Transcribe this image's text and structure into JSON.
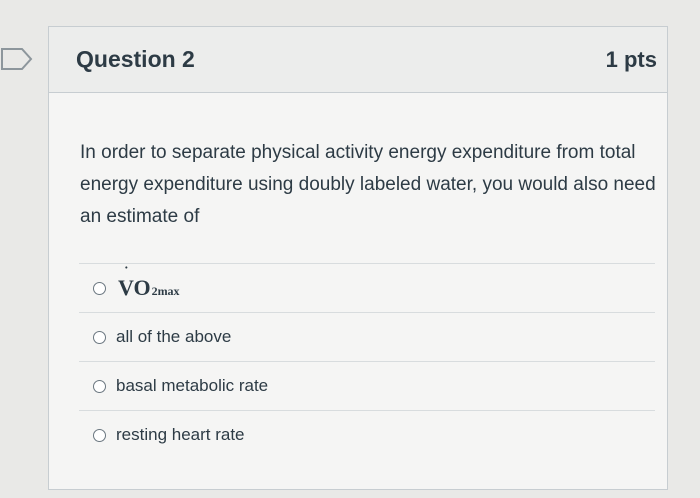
{
  "flag_icon": "bookmark-flag-icon",
  "question": {
    "title": "Question 2",
    "points": "1 pts",
    "text": "In order to separate physical activity energy expenditure from total energy expenditure using doubly labeled water, you would also need an estimate of"
  },
  "answers": [
    {
      "main": "VO",
      "dot": "˙",
      "sub": "2max"
    },
    {
      "label": "all of the above"
    },
    {
      "label": "basal metabolic rate"
    },
    {
      "label": "resting heart rate"
    }
  ]
}
